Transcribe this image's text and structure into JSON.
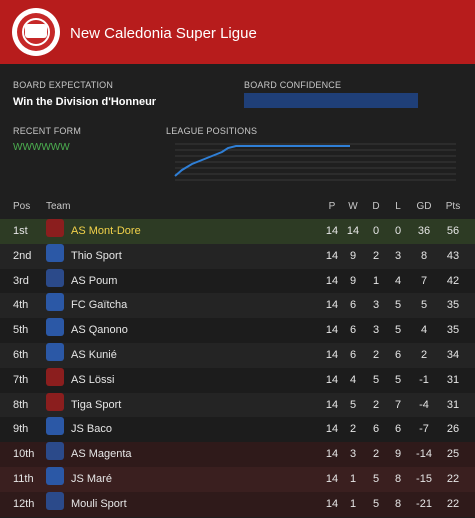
{
  "header": {
    "title": "New Caledonia Super Ligue",
    "brand_color": "#b71c1c"
  },
  "board": {
    "expectation_label": "BOARD EXPECTATION",
    "expectation_value": "Win the Division d'Honneur",
    "confidence_label": "BOARD CONFIDENCE",
    "confidence_color": "#1f3f78"
  },
  "recent_form": {
    "label": "RECENT FORM",
    "value": "WWWWWW"
  },
  "league_positions": {
    "label": "LEAGUE POSITIONS",
    "line_color": "#2f7fd6"
  },
  "table": {
    "headers": {
      "pos": "Pos",
      "team": "Team",
      "p": "P",
      "w": "W",
      "d": "D",
      "l": "L",
      "gd": "GD",
      "pts": "Pts"
    },
    "rows": [
      {
        "pos": "1st",
        "team": "AS Mont-Dore",
        "p": "14",
        "w": "14",
        "d": "0",
        "l": "0",
        "gd": "36",
        "pts": "56",
        "highlight": "own",
        "crest_icon": "bird-crest-icon"
      },
      {
        "pos": "2nd",
        "team": "Thio Sport",
        "p": "14",
        "w": "9",
        "d": "2",
        "l": "3",
        "gd": "8",
        "pts": "43",
        "highlight": "none",
        "crest_icon": "shield-crest-icon"
      },
      {
        "pos": "3rd",
        "team": "AS Poum",
        "p": "14",
        "w": "9",
        "d": "1",
        "l": "4",
        "gd": "7",
        "pts": "42",
        "highlight": "none",
        "crest_icon": "round-crest-icon"
      },
      {
        "pos": "4th",
        "team": "FC Gaïtcha",
        "p": "14",
        "w": "6",
        "d": "3",
        "l": "5",
        "gd": "5",
        "pts": "35",
        "highlight": "none",
        "crest_icon": "shield-crest-icon"
      },
      {
        "pos": "5th",
        "team": "AS Qanono",
        "p": "14",
        "w": "6",
        "d": "3",
        "l": "5",
        "gd": "4",
        "pts": "35",
        "highlight": "none",
        "crest_icon": "shield-crest-icon"
      },
      {
        "pos": "6th",
        "team": "AS Kunié",
        "p": "14",
        "w": "6",
        "d": "2",
        "l": "6",
        "gd": "2",
        "pts": "34",
        "highlight": "none",
        "crest_icon": "shield-crest-icon"
      },
      {
        "pos": "7th",
        "team": "AS Lössi",
        "p": "14",
        "w": "4",
        "d": "5",
        "l": "5",
        "gd": "-1",
        "pts": "31",
        "highlight": "none",
        "crest_icon": "bird-crest-icon"
      },
      {
        "pos": "8th",
        "team": "Tiga Sport",
        "p": "14",
        "w": "5",
        "d": "2",
        "l": "7",
        "gd": "-4",
        "pts": "31",
        "highlight": "none",
        "crest_icon": "bird-crest-icon"
      },
      {
        "pos": "9th",
        "team": "JS Baco",
        "p": "14",
        "w": "2",
        "d": "6",
        "l": "6",
        "gd": "-7",
        "pts": "26",
        "highlight": "none",
        "crest_icon": "shield-crest-icon"
      },
      {
        "pos": "10th",
        "team": "AS Magenta",
        "p": "14",
        "w": "3",
        "d": "2",
        "l": "9",
        "gd": "-14",
        "pts": "25",
        "highlight": "relegation",
        "crest_icon": "round-crest-icon"
      },
      {
        "pos": "11th",
        "team": "JS Maré",
        "p": "14",
        "w": "1",
        "d": "5",
        "l": "8",
        "gd": "-15",
        "pts": "22",
        "highlight": "relegation",
        "crest_icon": "shield-crest-icon"
      },
      {
        "pos": "12th",
        "team": "Mouli Sport",
        "p": "14",
        "w": "1",
        "d": "5",
        "l": "8",
        "gd": "-21",
        "pts": "22",
        "highlight": "relegation",
        "crest_icon": "round-crest-icon"
      }
    ]
  }
}
